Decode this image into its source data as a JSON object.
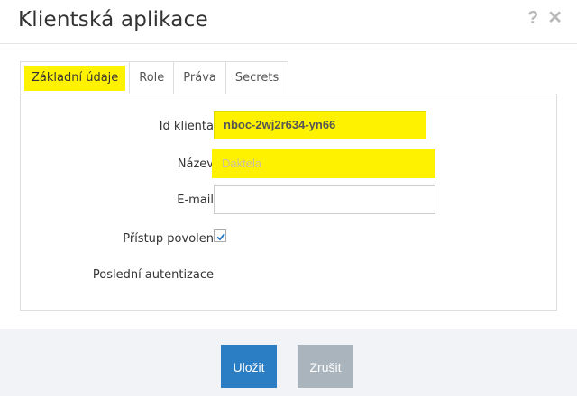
{
  "dialog": {
    "title": "Klientská aplikace",
    "help_icon": "?",
    "close_icon": "✕"
  },
  "tabs": [
    {
      "label": "Základní údaje",
      "active": true
    },
    {
      "label": "Role",
      "active": false
    },
    {
      "label": "Práva",
      "active": false
    },
    {
      "label": "Secrets",
      "active": false
    }
  ],
  "form": {
    "client_id": {
      "label": "Id klienta",
      "value": "nboc-2wj2r634-yn66"
    },
    "name": {
      "label": "Název",
      "placeholder": "Daktela"
    },
    "email": {
      "label": "E-mail",
      "value": ""
    },
    "access": {
      "label": "Přístup povolen",
      "checked": true
    },
    "last_auth": {
      "label": "Poslední autentizace",
      "value": ""
    }
  },
  "footer": {
    "save_label": "Uložit",
    "cancel_label": "Zrušit"
  },
  "colors": {
    "highlight": "#fff200",
    "primary": "#2c7ec4",
    "secondary": "#a9b4bd",
    "footer_bg": "#f1f3f6"
  }
}
